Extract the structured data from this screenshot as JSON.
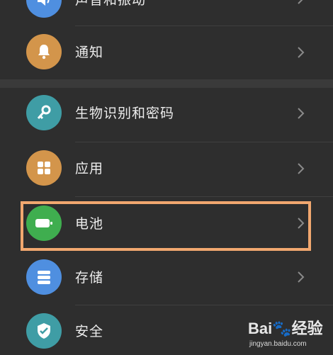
{
  "settings": {
    "items": [
      {
        "label": "声音和振动",
        "icon": "speaker-icon",
        "color": "#4f8fe0"
      },
      {
        "label": "通知",
        "icon": "bell-icon",
        "color": "#d3954b"
      },
      {
        "label": "生物识别和密码",
        "icon": "key-icon",
        "color": "#3f9da5"
      },
      {
        "label": "应用",
        "icon": "apps-grid-icon",
        "color": "#d3954b"
      },
      {
        "label": "电池",
        "icon": "battery-icon",
        "color": "#3fae4f"
      },
      {
        "label": "存储",
        "icon": "storage-icon",
        "color": "#4f8fe0"
      },
      {
        "label": "安全",
        "icon": "shield-check-icon",
        "color": "#3f9da5"
      }
    ],
    "highlighted_item": "电池",
    "highlight_color": "#f1a76f"
  },
  "watermark": {
    "logo": "Bai🐾经验",
    "url": "jingyan.baidu.com"
  }
}
